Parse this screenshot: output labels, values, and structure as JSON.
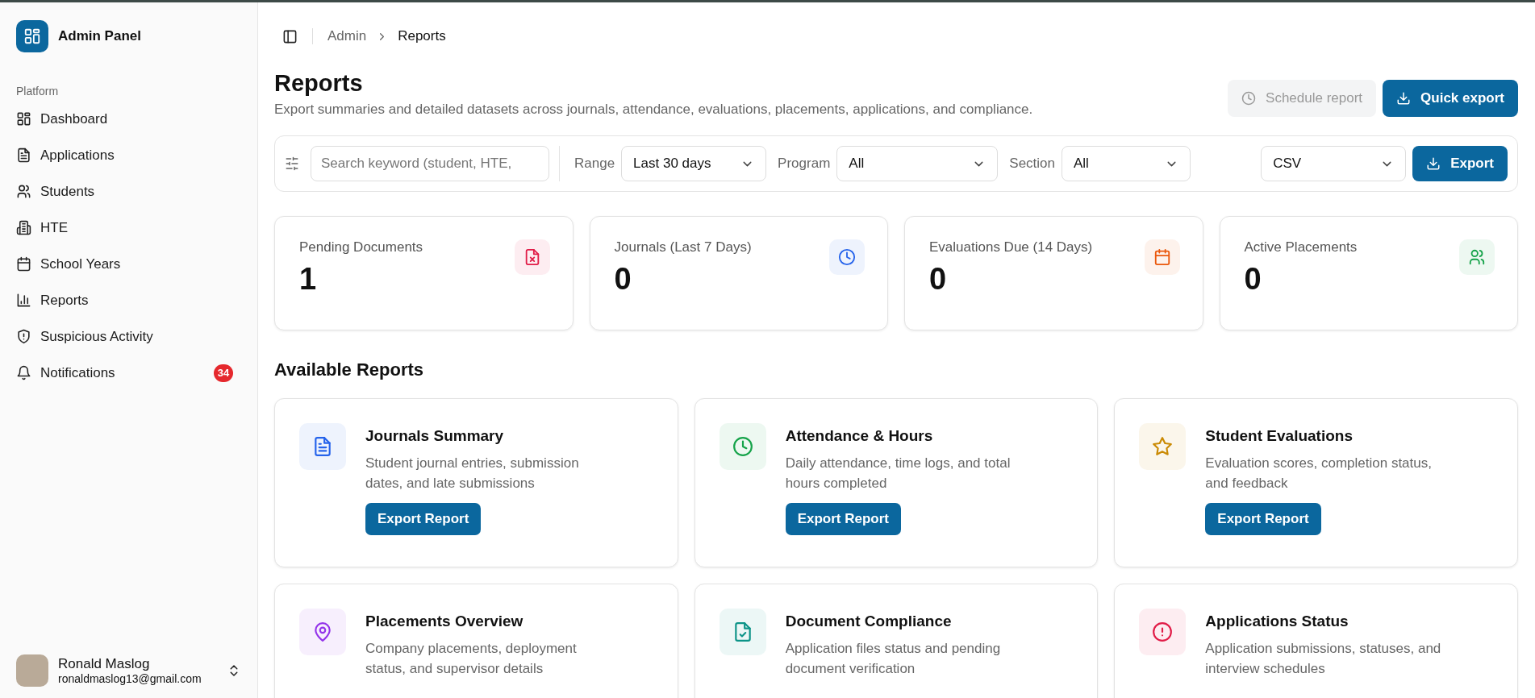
{
  "sidebar": {
    "brand": "Admin Panel",
    "section_label": "Platform",
    "items": [
      {
        "label": "Dashboard",
        "selected": false
      },
      {
        "label": "Applications",
        "selected": false
      },
      {
        "label": "Students",
        "selected": false
      },
      {
        "label": "HTE",
        "selected": false
      },
      {
        "label": "School Years",
        "selected": false
      },
      {
        "label": "Reports",
        "selected": false
      },
      {
        "label": "Suspicious Activity",
        "selected": false
      },
      {
        "label": "Notifications",
        "selected": false,
        "badge": "34"
      }
    ],
    "user": {
      "name": "Ronald Maslog",
      "email": "ronaldmaslog13@gmail.com"
    }
  },
  "breadcrumb": [
    "Admin",
    "Reports"
  ],
  "header": {
    "title": "Reports",
    "subtitle": "Export summaries and detailed datasets across journals, attendance, evaluations, placements, applications, and compliance.",
    "buttons": [
      {
        "label": "Schedule report",
        "kind": "secondary",
        "disabled": true
      },
      {
        "label": "Quick export",
        "kind": "primary",
        "disabled": false
      }
    ]
  },
  "filters": {
    "search": {
      "placeholder": "Search keyword (student, HTE,"
    },
    "selects": [
      {
        "label": "Range",
        "value": "Last 30 days"
      },
      {
        "label": "Program",
        "value": "All"
      },
      {
        "label": "Section",
        "value": "All"
      }
    ],
    "format": {
      "value": "CSV"
    },
    "export_button": "Export"
  },
  "stats": [
    {
      "label": "Pending Documents",
      "value": "1",
      "color": "#e11d48"
    },
    {
      "label": "Journals (Last 7 Days)",
      "value": "0",
      "color": "#2563eb"
    },
    {
      "label": "Evaluations Due (14 Days)",
      "value": "0",
      "color": "#ea580c"
    },
    {
      "label": "Active Placements",
      "value": "0",
      "color": "#16a34a"
    }
  ],
  "reports_heading": "Available Reports",
  "reports": [
    {
      "title": "Journals Summary",
      "description": "Student journal entries, submission dates, and late submissions",
      "button": "Export Report",
      "color": "#2563eb"
    },
    {
      "title": "Attendance & Hours",
      "description": "Daily attendance, time logs, and total hours completed",
      "button": "Export Report",
      "color": "#16a34a"
    },
    {
      "title": "Student Evaluations",
      "description": "Evaluation scores, completion status, and feedback",
      "button": "Export Report",
      "color": "#ca8a04"
    },
    {
      "title": "Placements Overview",
      "description": "Company placements, deployment status, and supervisor details",
      "color": "#9333ea"
    },
    {
      "title": "Document Compliance",
      "description": "Application files status and pending document verification",
      "color": "#0d9488"
    },
    {
      "title": "Applications Status",
      "description": "Application submissions, statuses, and interview schedules",
      "color": "#e11d48"
    }
  ]
}
